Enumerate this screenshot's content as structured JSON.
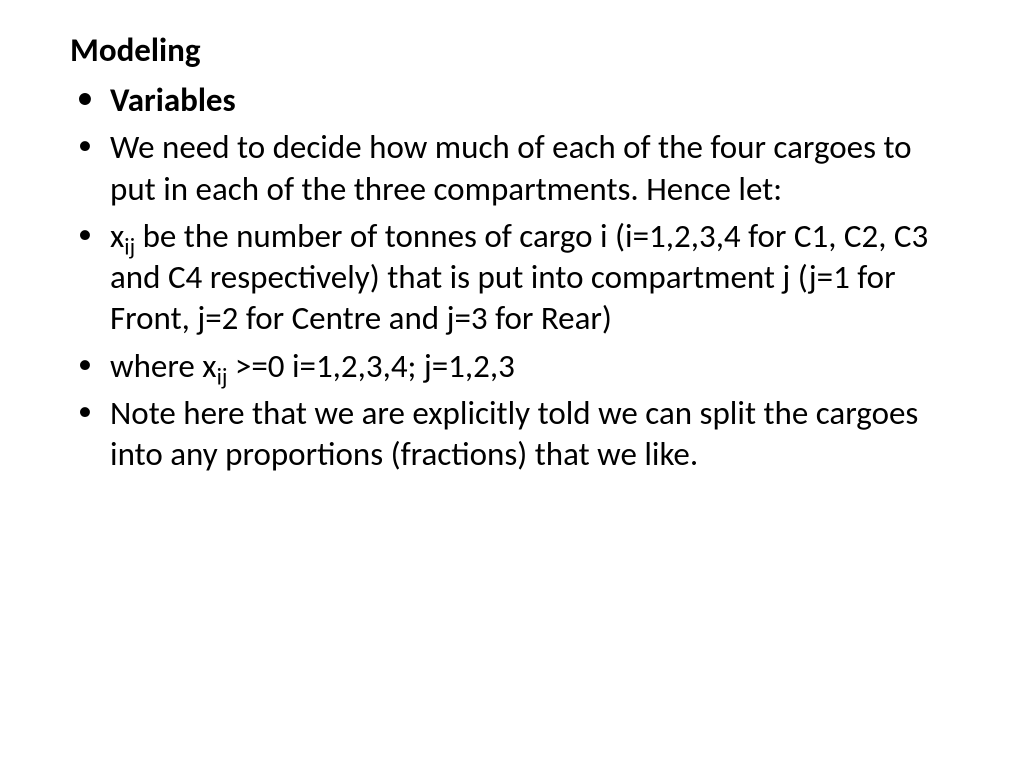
{
  "title": "Modeling",
  "bullets": {
    "b1": "Variables",
    "b2": "We need to decide how much of each of the four cargoes to put in each of the three compartments. Hence let:",
    "b3_pre": "x",
    "b3_sub": "ij",
    "b3_post": " be the number of tonnes of cargo i (i=1,2,3,4 for C1, C2, C3 and C4 respectively) that is put into compartment j (j=1 for Front, j=2 for Centre and j=3 for Rear)",
    "b4_pre": "where x",
    "b4_sub": "ij",
    "b4_post": " >=0 i=1,2,3,4; j=1,2,3",
    "b5": "Note here that we are explicitly told we can split the cargoes into any proportions (fractions) that we like."
  }
}
